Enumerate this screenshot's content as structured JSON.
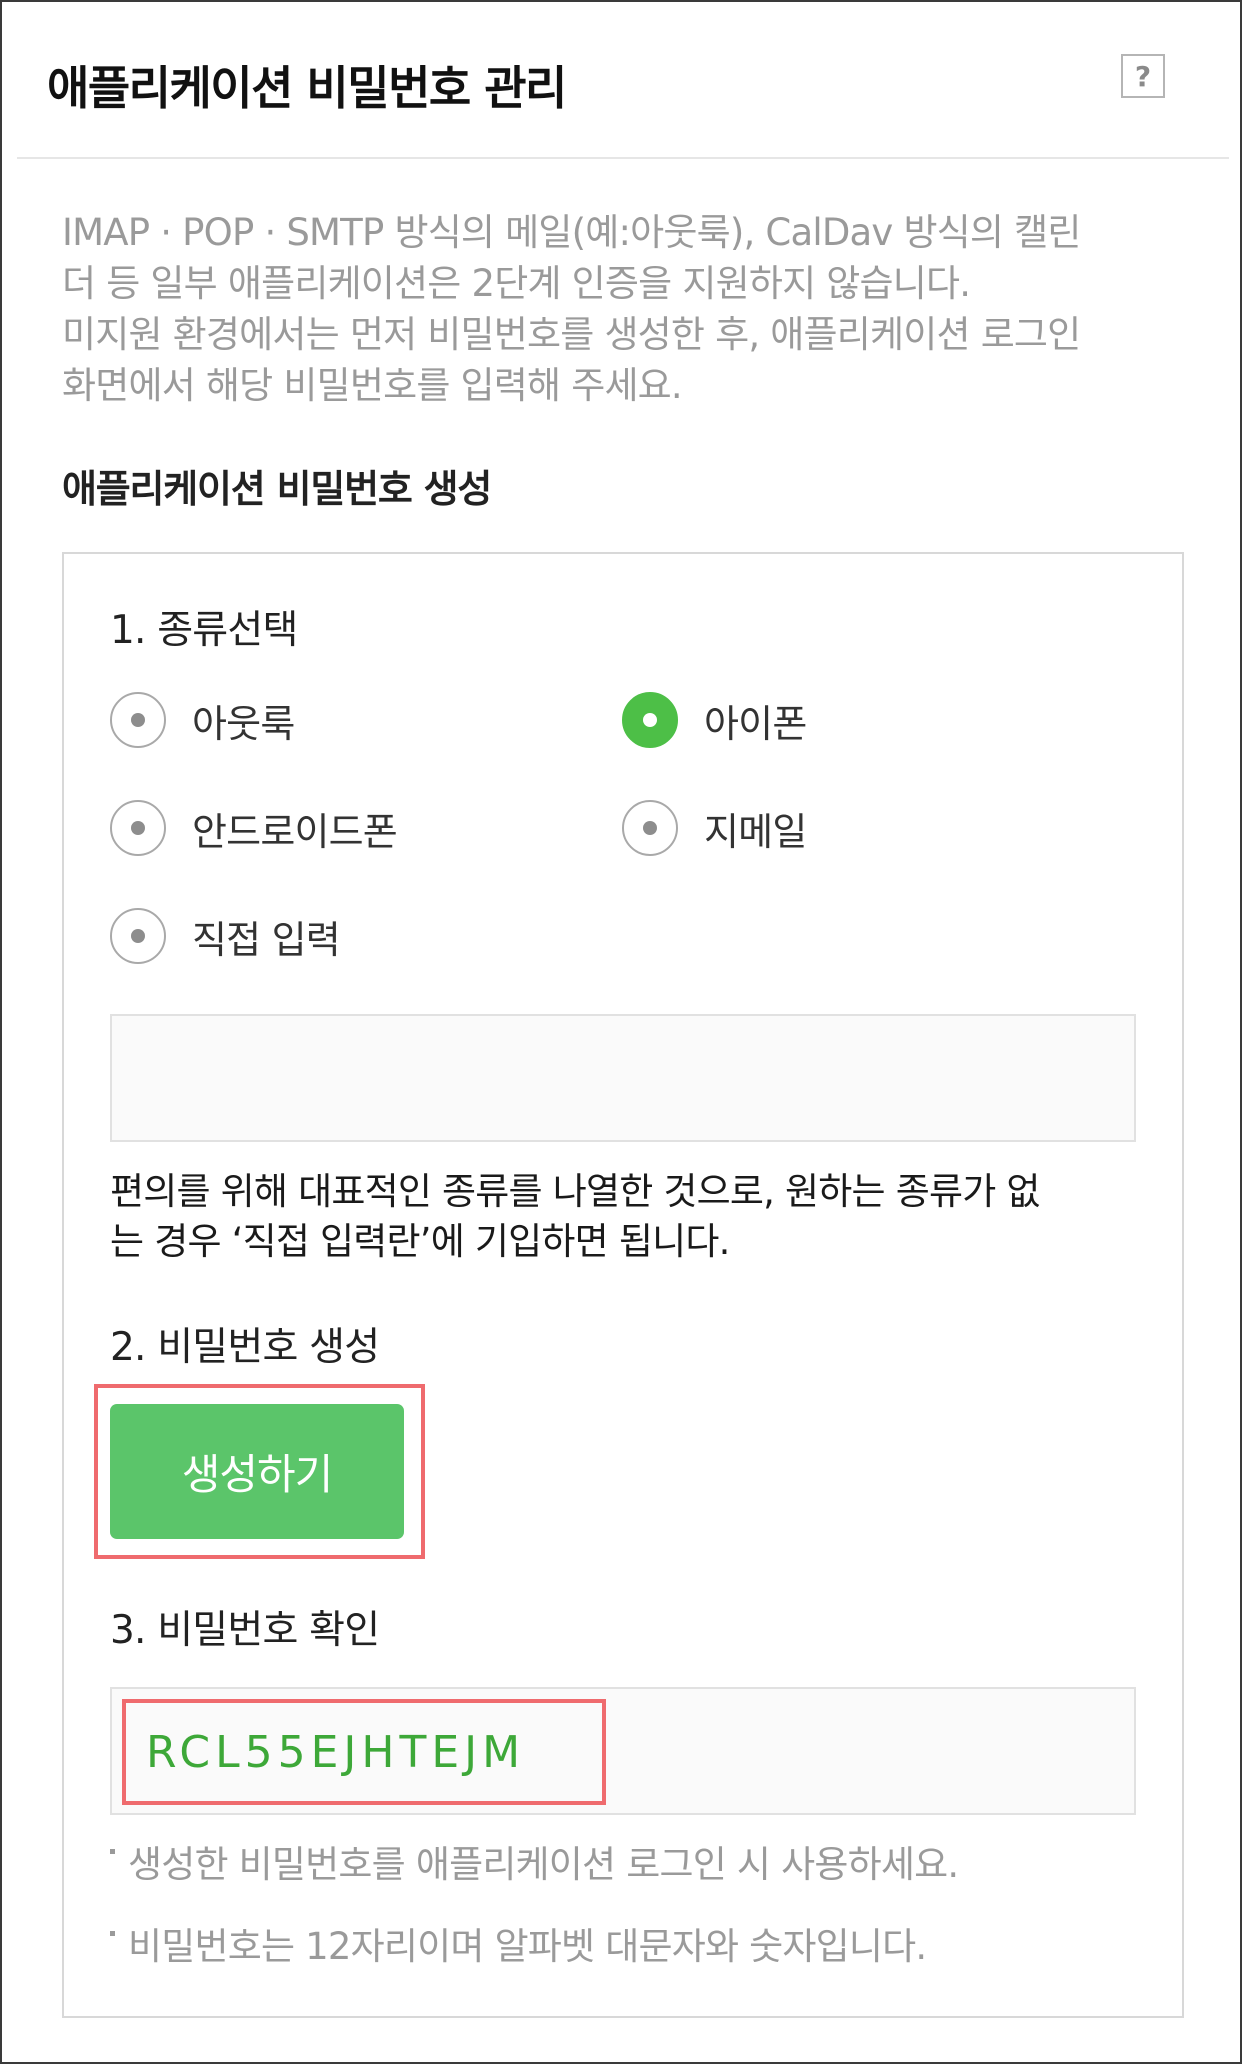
{
  "header": {
    "title": "애플리케이션 비밀번호 관리",
    "help_label": "?"
  },
  "intro": {
    "lines": [
      "IMAP · POP · SMTP 방식의 메일(예:아웃룩), CalDav 방식의 캘린",
      "더 등 일부 애플리케이션은 2단계 인증을 지원하지 않습니다.",
      "미지원 환경에서는 먼저 비밀번호를 생성한 후, 애플리케이션 로그인",
      "화면에서 해당 비밀번호를 입력해 주세요."
    ]
  },
  "section_title": "애플리케이션 비밀번호 생성",
  "step1": {
    "title": "1. 종류선택",
    "options": [
      {
        "label": "아웃룩",
        "checked": false
      },
      {
        "label": "아이폰",
        "checked": true
      },
      {
        "label": "안드로이드폰",
        "checked": false
      },
      {
        "label": "지메일",
        "checked": false
      },
      {
        "label": "직접 입력",
        "checked": false
      }
    ],
    "custom_input_value": "",
    "note_lines": [
      "편의를 위해 대표적인 종류를 나열한 것으로, 원하는 종류가 없",
      "는 경우 ‘직접 입력란’에 기입하면 됩니다."
    ]
  },
  "step2": {
    "title": "2. 비밀번호 생성",
    "button_label": "생성하기"
  },
  "step3": {
    "title": "3. 비밀번호 확인",
    "password": "RCL55EJHTEJM",
    "bullets": [
      "생성한 비밀번호를 애플리케이션 로그인 시 사용하세요.",
      "비밀번호는 12자리이며 알파벳 대문자와 숫자입니다."
    ]
  },
  "colors": {
    "accent_green": "#5bc56a",
    "password_green": "#3da838",
    "highlight_red": "#ef6b6e"
  }
}
